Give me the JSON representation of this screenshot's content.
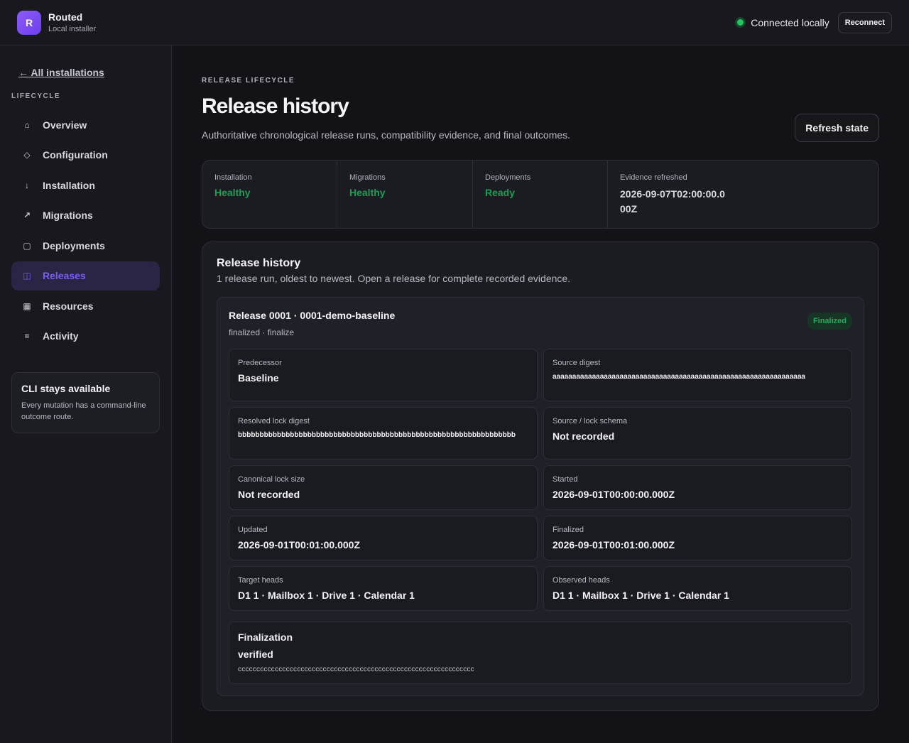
{
  "app": {
    "logo_letter": "R",
    "name": "Routed",
    "subtitle": "Local installer"
  },
  "connection": {
    "status": "Connected locally",
    "reconnect_label": "Reconnect",
    "status_color": "#22c55e"
  },
  "sidebar": {
    "back_label": "← All installations",
    "section_label": "LIFECYCLE",
    "items": [
      {
        "label": "Overview",
        "icon": "home-icon",
        "glyph": "⌂"
      },
      {
        "label": "Configuration",
        "icon": "diamond-icon",
        "glyph": "◇"
      },
      {
        "label": "Installation",
        "icon": "arrow-down-icon",
        "glyph": "↓"
      },
      {
        "label": "Migrations",
        "icon": "arrow-up-right-icon",
        "glyph": "↗"
      },
      {
        "label": "Deployments",
        "icon": "square-icon",
        "glyph": "▢"
      },
      {
        "label": "Releases",
        "icon": "columns-icon",
        "glyph": "◫"
      },
      {
        "label": "Resources",
        "icon": "grid-icon",
        "glyph": "▦"
      },
      {
        "label": "Activity",
        "icon": "list-icon",
        "glyph": "≡"
      }
    ],
    "active_item": "Releases",
    "cli": {
      "title": "CLI stays available",
      "text": "Every mutation has a command-line outcome route."
    }
  },
  "page": {
    "eyebrow": "RELEASE LIFECYCLE",
    "title": "Release history",
    "subtitle": "Authoritative chronological release runs, compatibility evidence, and final outcomes.",
    "refresh_label": "Refresh state"
  },
  "status": {
    "installation": {
      "label": "Installation",
      "value": "Healthy"
    },
    "migrations": {
      "label": "Migrations",
      "value": "Healthy"
    },
    "deployments": {
      "label": "Deployments",
      "value": "Ready"
    },
    "evidence": {
      "label": "Evidence refreshed",
      "value": "2026-09-07T02:00:00.000Z"
    }
  },
  "history": {
    "title": "Release history",
    "subtitle": "1 release run, oldest to newest. Open a release for complete recorded evidence.",
    "release": {
      "title": "Release 0001 · 0001-demo-baseline",
      "subtitle": "finalized · finalize",
      "badge": "Finalized",
      "fields": {
        "predecessor": {
          "label": "Predecessor",
          "value": "Baseline"
        },
        "source_digest": {
          "label": "Source digest",
          "value": "aaaaaaaaaaaaaaaaaaaaaaaaaaaaaaaaaaaaaaaaaaaaaaaaaaaaaaaaaaaaaaaa"
        },
        "resolved_lock_digest": {
          "label": "Resolved lock digest",
          "value": "bbbbbbbbbbbbbbbbbbbbbbbbbbbbbbbbbbbbbbbbbbbbbbbbbbbbbbbbbbbbbbbb"
        },
        "source_lock_schema": {
          "label": "Source / lock schema",
          "value": "Not recorded"
        },
        "canonical_lock_size": {
          "label": "Canonical lock size",
          "value": "Not recorded"
        },
        "started": {
          "label": "Started",
          "value": "2026-09-01T00:00:00.000Z"
        },
        "updated": {
          "label": "Updated",
          "value": "2026-09-01T00:01:00.000Z"
        },
        "finalized": {
          "label": "Finalized",
          "value": "2026-09-01T00:01:00.000Z"
        },
        "target_heads": {
          "label": "Target heads",
          "value": "D1 1 · Mailbox 1 · Drive 1 · Calendar 1"
        },
        "observed_heads": {
          "label": "Observed heads",
          "value": "D1 1 · Mailbox 1 · Drive 1 · Calendar 1"
        }
      },
      "finalization": {
        "title": "Finalization",
        "value": "verified",
        "hash": "cccccccccccccccccccccccccccccccccccccccccccccccccccccccccccccccc"
      }
    }
  }
}
